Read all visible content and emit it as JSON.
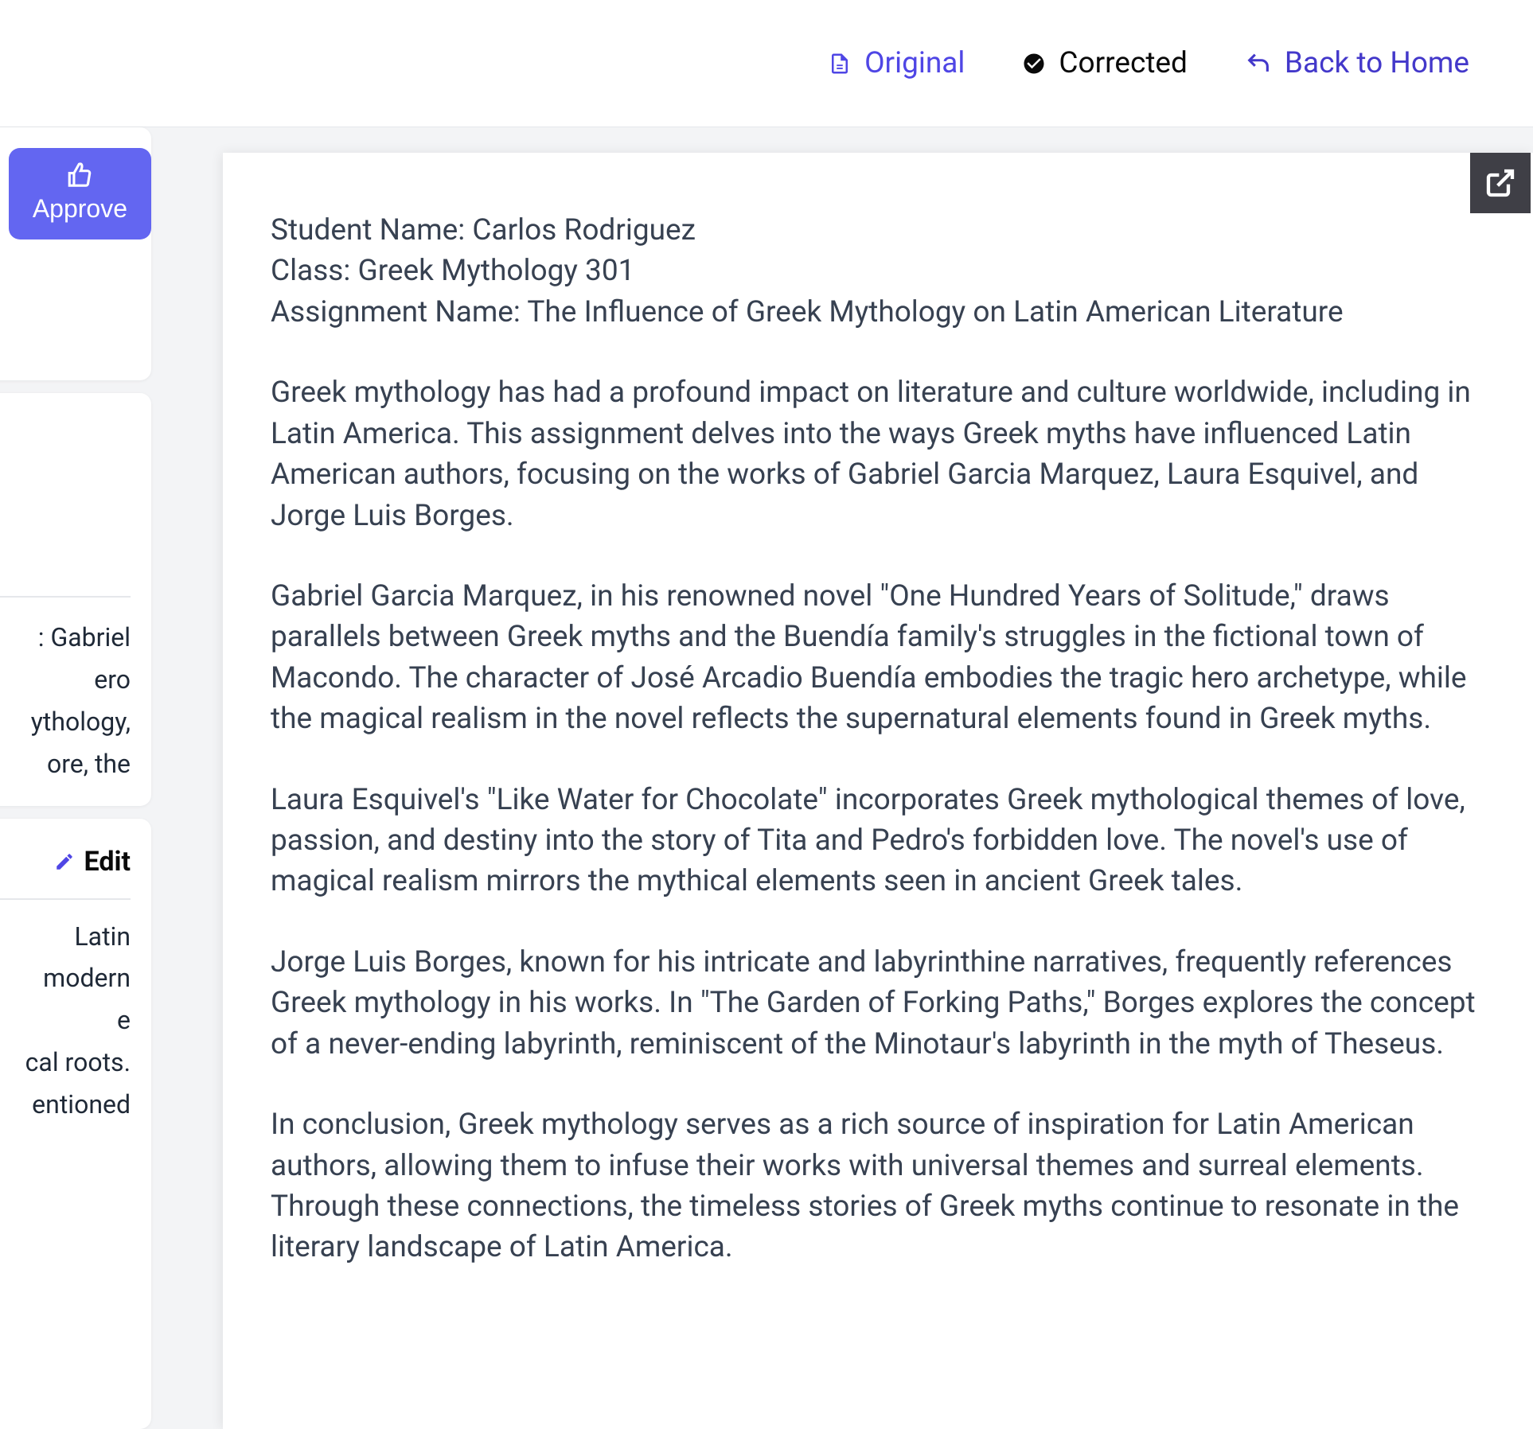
{
  "header": {
    "original_label": "Original",
    "corrected_label": "Corrected",
    "back_label": "Back to Home"
  },
  "sidebar": {
    "approve_label": "Approve",
    "edit_label": "Edit",
    "partial_text_1_lines": ": Gabriel\nero\nythology,\nore, the",
    "partial_text_2_lines": "Latin\nmodern\ne\ncal roots.\nentioned"
  },
  "document": {
    "header_lines": "Student Name: Carlos Rodriguez\nClass: Greek Mythology 301\nAssignment Name: The Influence of Greek Mythology on Latin American Literature",
    "paragraphs": [
      "Greek mythology has had a profound impact on literature and culture worldwide, including in Latin America. This assignment delves into the ways Greek myths have influenced Latin American authors, focusing on the works of Gabriel Garcia Marquez, Laura Esquivel, and Jorge Luis Borges.",
      "Gabriel Garcia Marquez, in his renowned novel \"One Hundred Years of Solitude,\" draws parallels between Greek myths and the Buendía family's struggles in the fictional town of Macondo. The character of José Arcadio Buendía embodies the tragic hero archetype, while the magical realism in the novel reflects the supernatural elements found in Greek myths.",
      "Laura Esquivel's \"Like Water for Chocolate\" incorporates Greek mythological themes of love, passion, and destiny into the story of Tita and Pedro's forbidden love. The novel's use of magical realism mirrors the mythical elements seen in ancient Greek tales.",
      "Jorge Luis Borges, known for his intricate and labyrinthine narratives, frequently references Greek mythology in his works. In \"The Garden of Forking Paths,\" Borges explores the concept of a never-ending labyrinth, reminiscent of the Minotaur's labyrinth in the myth of Theseus.",
      "In conclusion, Greek mythology serves as a rich source of inspiration for Latin American authors, allowing them to infuse their works with universal themes and surreal elements. Through these connections, the timeless stories of Greek myths continue to resonate in the literary landscape of Latin America."
    ]
  }
}
